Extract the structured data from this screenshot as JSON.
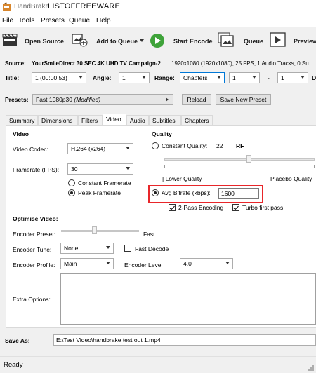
{
  "titlebar": {
    "app_name": "HandBrake",
    "brand": "LISTOFFREEWARE"
  },
  "menu": [
    "File",
    "Tools",
    "Presets",
    "Queue",
    "Help"
  ],
  "toolbar": {
    "open_source": "Open Source",
    "add_to_queue": "Add to Queue",
    "start_encode": "Start Encode",
    "queue": "Queue",
    "preview": "Preview"
  },
  "source": {
    "label": "Source:",
    "name": "YourSmileDirect 30 SEC 4K UHD TV Campaign-2",
    "info": "1920x1080 (1920x1080), 25 FPS, 1 Audio Tracks, 0 Su"
  },
  "title_row": {
    "title_label": "Title:",
    "title_value": "1 (00:00:53)",
    "angle_label": "Angle:",
    "angle_value": "1",
    "range_label": "Range:",
    "range_value": "Chapters",
    "range_start": "1",
    "range_sep": "-",
    "range_end": "1",
    "trailing": "D"
  },
  "presets": {
    "label": "Presets:",
    "value": "Fast 1080p30",
    "modified": "(Modified)",
    "reload": "Reload",
    "save_new": "Save New Preset"
  },
  "tabs": [
    "Summary",
    "Dimensions",
    "Filters",
    "Video",
    "Audio",
    "Subtitles",
    "Chapters"
  ],
  "active_tab": "Video",
  "video": {
    "heading": "Video",
    "codec_label": "Video Codec:",
    "codec_value": "H.264 (x264)",
    "framerate_label": "Framerate (FPS):",
    "framerate_value": "30",
    "constant_framerate": "Constant Framerate",
    "peak_framerate": "Peak Framerate"
  },
  "quality": {
    "heading": "Quality",
    "constant_quality": "Constant Quality:",
    "cq_value": "22",
    "rf": "RF",
    "lower_quality": "| Lower Quality",
    "placebo_quality": "Placebo Quality",
    "avg_bitrate_label": "Avg Bitrate (kbps):",
    "avg_bitrate_value": "1600",
    "two_pass": "2-Pass Encoding",
    "turbo": "Turbo first pass"
  },
  "optimise": {
    "heading": "Optimise Video:",
    "preset_label": "Encoder Preset:",
    "preset_value": "Fast",
    "tune_label": "Encoder Tune:",
    "tune_value": "None",
    "fast_decode": "Fast Decode",
    "profile_label": "Encoder Profile:",
    "profile_value": "Main",
    "level_label": "Encoder Level",
    "level_value": "4.0",
    "extra_label": "Extra Options:",
    "extra_value": ""
  },
  "save_as": {
    "label": "Save As:",
    "value": "E:\\Test Video\\handbrake test out 1.mp4"
  },
  "status": "Ready",
  "colors": {
    "highlight": "#e8262a",
    "play_green": "#3fa33a",
    "window_bg": "#f0f0f0"
  }
}
